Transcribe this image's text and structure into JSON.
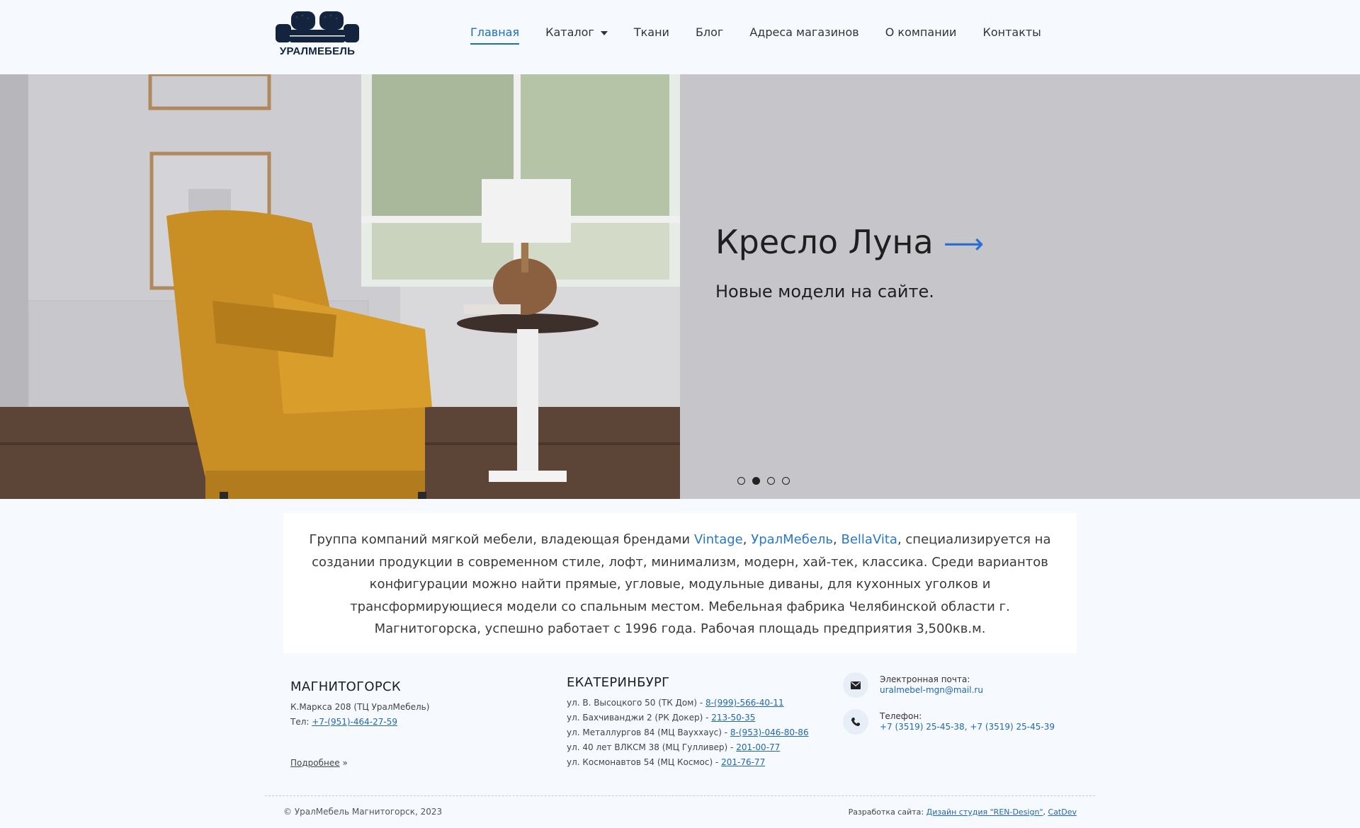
{
  "header": {
    "logo_text": "УРАЛМЕБЕЛЬ",
    "nav": [
      {
        "label": "Главная",
        "active": true
      },
      {
        "label": "Каталог",
        "has_dropdown": true
      },
      {
        "label": "Ткани"
      },
      {
        "label": "Блог"
      },
      {
        "label": "Адреса магазинов"
      },
      {
        "label": "О компании"
      },
      {
        "label": "Контакты"
      }
    ]
  },
  "hero": {
    "title": "Кресло Луна",
    "arrow": "⟶",
    "subtitle": "Новые модели на сайте.",
    "slides_count": 4,
    "active_slide": 2
  },
  "intro": {
    "text_before": "Группа компаний мягкой мебели, владеющая брендами ",
    "brands": [
      "Vintage",
      "УралМебель",
      "BellaVita"
    ],
    "text_after": ", специализируется на создании продукции в современном стиле, лофт, минимализм, модерн, хай-тек, классика. Среди вариантов конфигурации можно найти прямые, угловые, модульные диваны, для кухонных уголков и трансформирующиеся модели со спальным местом. Мебельная фабрика Челябинской области г. Магнитогорска, успешно работает с 1996 года. Рабочая площадь предприятия 3,500кв.м."
  },
  "magnitogorsk": {
    "city": "МАГНИТОГОРСК",
    "address": "К.Маркса 208 (ТЦ УралМебель)",
    "phone_label": "Тел: ",
    "phone": "+7-(951)-464-27-59",
    "more_label": "Подробнее",
    "more_suffix": " »"
  },
  "ekaterinburg": {
    "city": "ЕКАТЕРИНБУРГ",
    "stores": [
      {
        "address": "ул. В. Высоцкого 50 (ТК Дом) - ",
        "phone": "8-(999)-566-40-11"
      },
      {
        "address": "ул. Бахчиванджи 2 (РК Докер) - ",
        "phone": "213-50-35"
      },
      {
        "address": "ул. Металлургов 84 (МЦ Вауххаус) - ",
        "phone": "8-(953)-046-80-86"
      },
      {
        "address": "ул. 40 лет ВЛКСМ 38 (МЦ Гулливер) - ",
        "phone": "201-00-77"
      },
      {
        "address": "ул. Космонавтов 54 (МЦ Космос) - ",
        "phone": "201-76-77"
      }
    ]
  },
  "contacts": {
    "email_label": "Электронная почта:",
    "email": "uralmebel-mgn@mail.ru",
    "phone_label": "Телефон:",
    "phones": "+7 (3519) 25-45-38, +7 (3519) 25-45-39"
  },
  "footer": {
    "copyright": "© УралМебель Магнитогорск, 2023",
    "dev_label": "Разработка сайта: ",
    "dev_link1": "Дизайн студия \"REN-Design\"",
    "dev_sep": ", ",
    "dev_link2": "CatDev"
  },
  "colors": {
    "accent": "#1b6fb8",
    "brand_navy": "#14243e",
    "hero_bg": "#c6c6ca"
  }
}
